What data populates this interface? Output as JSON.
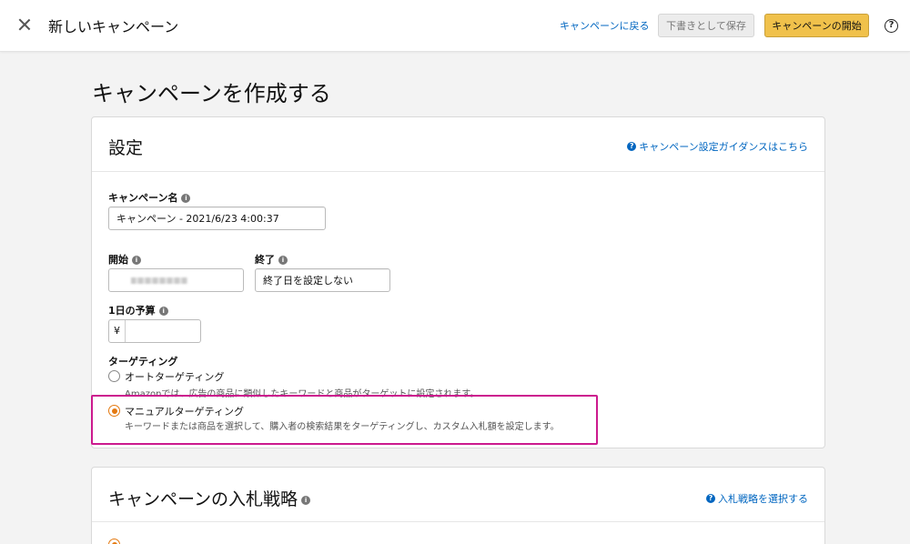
{
  "header": {
    "title": "新しいキャンペーン",
    "back_link": "キャンペーンに戻る",
    "draft_button": "下書きとして保存",
    "start_button": "キャンペーンの開始",
    "help_label": "?"
  },
  "page": {
    "title": "キャンペーンを作成する"
  },
  "settings": {
    "title": "設定",
    "guide_link": "キャンペーン設定ガイダンスはこちら",
    "campaign_name": {
      "label": "キャンペーン名",
      "value": "キャンペーン - 2021/6/23 4:00:37"
    },
    "start": {
      "label": "開始"
    },
    "end": {
      "label": "終了",
      "value": "終了日を設定しない"
    },
    "budget": {
      "label": "1日の予算",
      "currency": "¥",
      "value": ""
    },
    "targeting": {
      "label": "ターゲティング",
      "auto": {
        "label": "オートターゲティング",
        "desc": "Amazonでは、広告の商品に類似したキーワードと商品がターゲットに設定されます。"
      },
      "manual": {
        "label": "マニュアルターゲティング",
        "desc": "キーワードまたは商品を選択して、購入者の検索結果をターゲティングし、カスタム入札額を設定します。"
      }
    }
  },
  "bidding": {
    "title": "キャンペーンの入札戦略",
    "link": "入札戦略を選択する"
  },
  "colors": {
    "accent": "#f0c14b",
    "link": "#0066c0",
    "radio": "#e47911",
    "highlight": "#cc1a8e"
  },
  "icons": {
    "close": "close-icon",
    "help": "help-icon",
    "info": "info-icon",
    "question": "question-circle-icon"
  }
}
